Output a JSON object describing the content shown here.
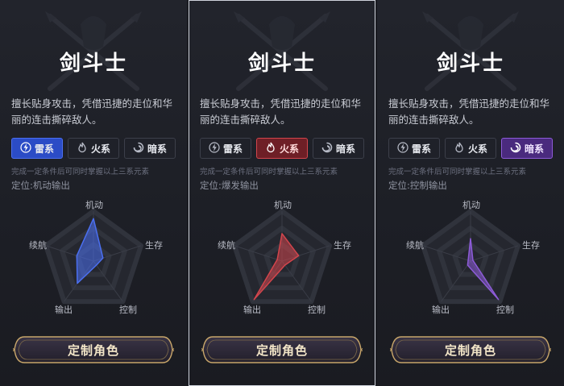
{
  "cards": [
    {
      "title": "剑斗士",
      "desc_line1": "擅长贴身攻击，凭借迅捷的走位和华",
      "desc_line2": "丽的连击撕碎敌人。",
      "elements": [
        "雷系",
        "火系",
        "暗系"
      ],
      "active_element": "雷系",
      "hint": "完成一定条件后可同时掌握以上三系元素",
      "role": "定位:机动输出",
      "radar_labels": [
        "机动",
        "生存",
        "控制",
        "输出",
        "续航"
      ],
      "radar_values": {
        "机动": 0.85,
        "生存": 0.2,
        "控制": 0.1,
        "输出": 0.55,
        "续航": 0.35
      },
      "accent": "#4b6ff0",
      "cta": "定制角色"
    },
    {
      "title": "剑斗士",
      "desc_line1": "擅长贴身攻击，凭借迅捷的走位和华",
      "desc_line2": "丽的连击撕碎敌人。",
      "elements": [
        "雷系",
        "火系",
        "暗系"
      ],
      "active_element": "火系",
      "hint": "完成一定条件后可同时掌握以上三系元素",
      "role": "定位:爆发输出",
      "radar_labels": [
        "机动",
        "生存",
        "控制",
        "输出",
        "续航"
      ],
      "radar_values": {
        "机动": 0.55,
        "生存": 0.35,
        "控制": 0.1,
        "输出": 0.95,
        "续航": 0.1
      },
      "accent": "#d2454c",
      "cta": "定制角色"
    },
    {
      "title": "剑斗士",
      "desc_line1": "擅长贴身攻击，凭借迅捷的走位和华",
      "desc_line2": "丽的连击撕碎敌人。",
      "elements": [
        "雷系",
        "火系",
        "暗系"
      ],
      "active_element": "暗系",
      "hint": "完成一定条件后可同时掌握以上三系元素",
      "role": "定位:控制输出",
      "radar_labels": [
        "机动",
        "生存",
        "控制",
        "输出",
        "续航"
      ],
      "radar_values": {
        "机动": 0.45,
        "生存": 0.05,
        "控制": 0.95,
        "输出": 0.1,
        "续航": 0.05
      },
      "accent": "#8d5bd8",
      "cta": "定制角色"
    }
  ],
  "selected_index": 1
}
